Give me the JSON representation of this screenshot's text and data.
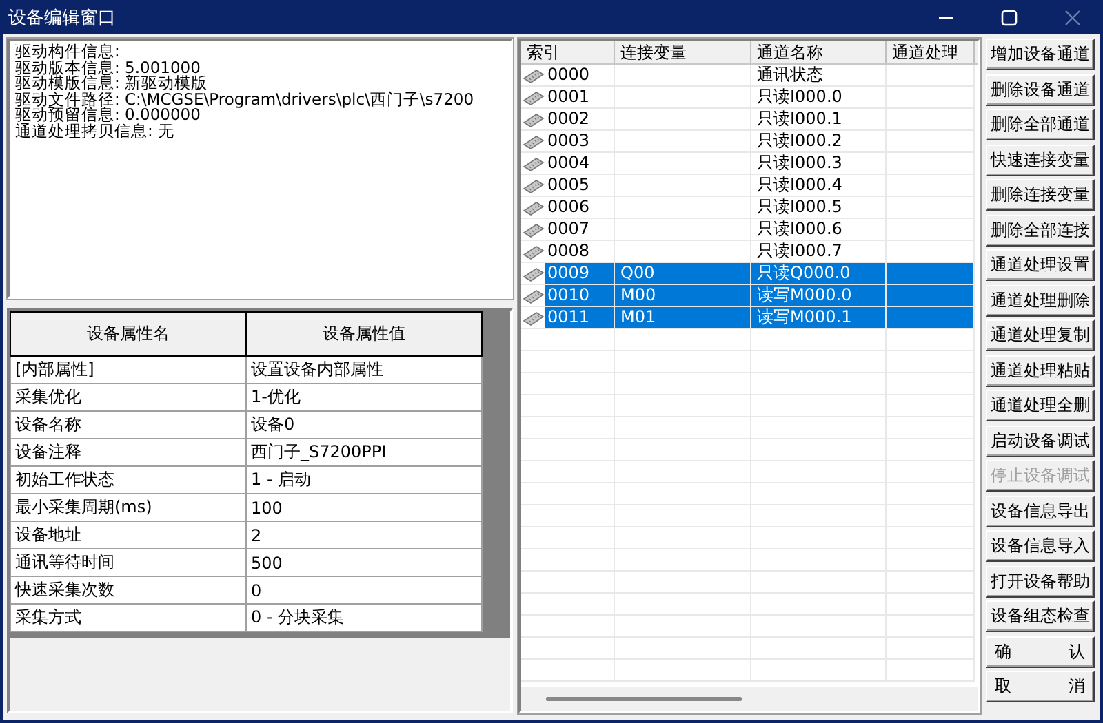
{
  "window": {
    "title": "设备编辑窗口"
  },
  "info_lines": [
    "驱动构件信息:",
    "驱动版本信息: 5.001000",
    "驱动模版信息: 新驱动模版",
    "驱动文件路径: C:\\MCGSE\\Program\\drivers\\plc\\西门子\\s7200",
    "驱动预留信息: 0.000000",
    "通道处理拷贝信息: 无"
  ],
  "properties": {
    "columns": [
      "设备属性名",
      "设备属性值"
    ],
    "rows": [
      [
        "[内部属性]",
        "设置设备内部属性"
      ],
      [
        "采集优化",
        "1-优化"
      ],
      [
        "设备名称",
        "设备0"
      ],
      [
        "设备注释",
        "西门子_S7200PPI"
      ],
      [
        "初始工作状态",
        "1 - 启动"
      ],
      [
        "最小采集周期(ms)",
        "100"
      ],
      [
        "设备地址",
        "2"
      ],
      [
        "通讯等待时间",
        "500"
      ],
      [
        "快速采集次数",
        "0"
      ],
      [
        "采集方式",
        "0 - 分块采集"
      ]
    ]
  },
  "channels": {
    "columns": [
      "索引",
      "连接变量",
      "通道名称",
      "通道处理"
    ],
    "rows": [
      {
        "index": "0000",
        "variable": "",
        "name": "通讯状态",
        "selected": false
      },
      {
        "index": "0001",
        "variable": "",
        "name": "只读I000.0",
        "selected": false
      },
      {
        "index": "0002",
        "variable": "",
        "name": "只读I000.1",
        "selected": false
      },
      {
        "index": "0003",
        "variable": "",
        "name": "只读I000.2",
        "selected": false
      },
      {
        "index": "0004",
        "variable": "",
        "name": "只读I000.3",
        "selected": false
      },
      {
        "index": "0005",
        "variable": "",
        "name": "只读I000.4",
        "selected": false
      },
      {
        "index": "0006",
        "variable": "",
        "name": "只读I000.5",
        "selected": false
      },
      {
        "index": "0007",
        "variable": "",
        "name": "只读I000.6",
        "selected": false
      },
      {
        "index": "0008",
        "variable": "",
        "name": "只读I000.7",
        "selected": false
      },
      {
        "index": "0009",
        "variable": "Q00",
        "name": "只读Q000.0",
        "selected": true
      },
      {
        "index": "0010",
        "variable": "M00",
        "name": "读写M000.0",
        "selected": true
      },
      {
        "index": "0011",
        "variable": "M01",
        "name": "读写M000.1",
        "selected": true
      }
    ]
  },
  "buttons": [
    {
      "label": "增加设备通道",
      "disabled": false
    },
    {
      "label": "删除设备通道",
      "disabled": false
    },
    {
      "label": "删除全部通道",
      "disabled": false
    },
    {
      "label": "快速连接变量",
      "disabled": false
    },
    {
      "label": "删除连接变量",
      "disabled": false
    },
    {
      "label": "删除全部连接",
      "disabled": false
    },
    {
      "label": "通道处理设置",
      "disabled": false
    },
    {
      "label": "通道处理删除",
      "disabled": false
    },
    {
      "label": "通道处理复制",
      "disabled": false
    },
    {
      "label": "通道处理粘贴",
      "disabled": false
    },
    {
      "label": "通道处理全删",
      "disabled": false
    },
    {
      "label": "启动设备调试",
      "disabled": false
    },
    {
      "label": "停止设备调试",
      "disabled": true
    },
    {
      "label": "设备信息导出",
      "disabled": false
    },
    {
      "label": "设备信息导入",
      "disabled": false
    },
    {
      "label": "打开设备帮助",
      "disabled": false
    },
    {
      "label": "设备组态检查",
      "disabled": false
    },
    {
      "label": "确 认",
      "disabled": false
    },
    {
      "label": "取 消",
      "disabled": false
    }
  ]
}
